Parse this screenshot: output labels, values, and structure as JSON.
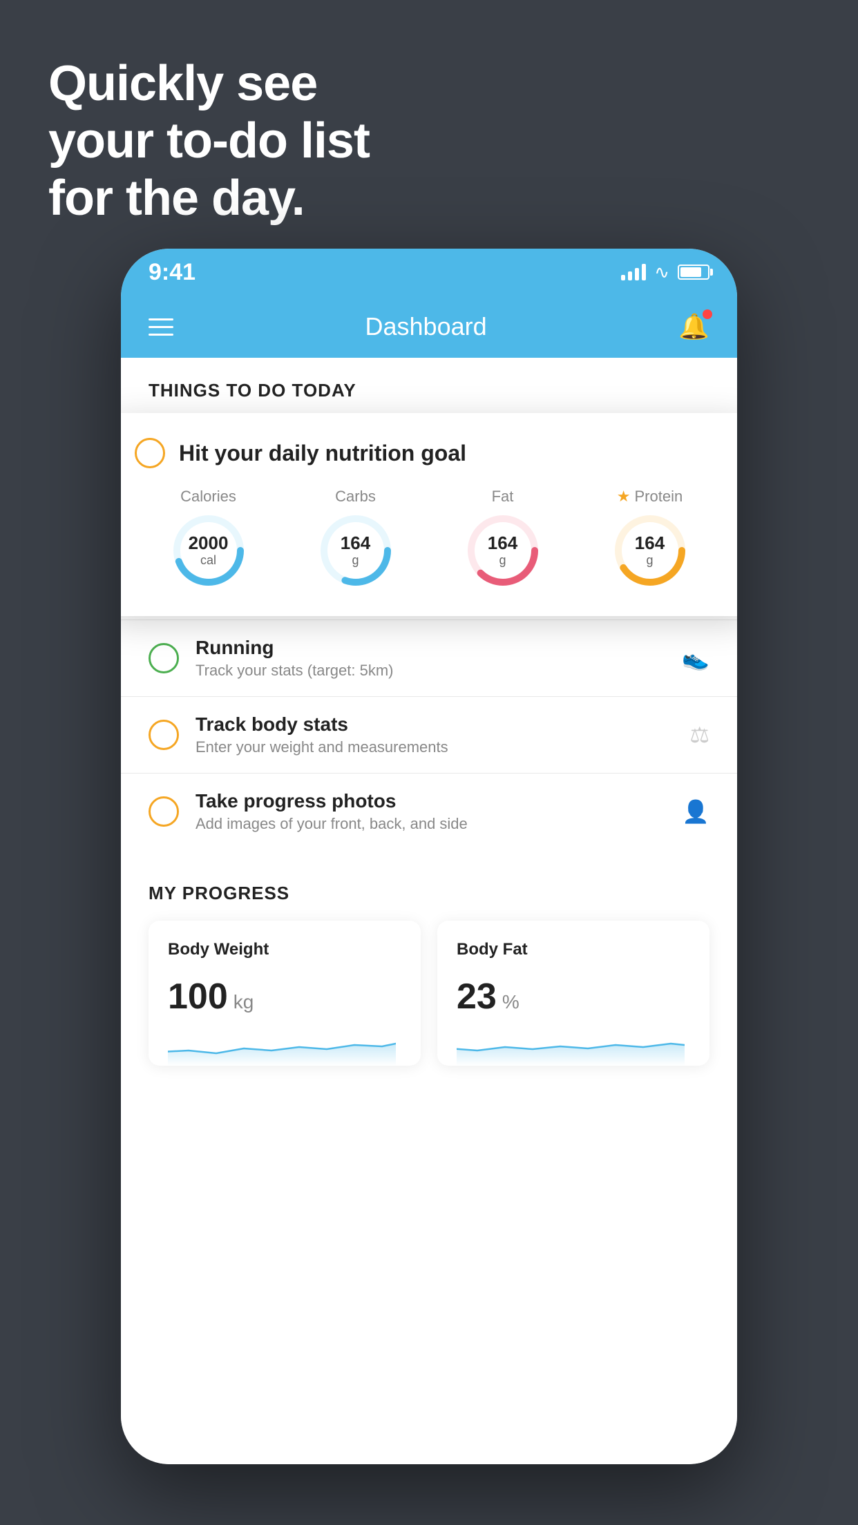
{
  "headline": {
    "line1": "Quickly see",
    "line2": "your to-do list",
    "line3": "for the day."
  },
  "statusBar": {
    "time": "9:41"
  },
  "header": {
    "title": "Dashboard"
  },
  "thingsToDo": {
    "sectionTitle": "THINGS TO DO TODAY"
  },
  "nutritionCard": {
    "title": "Hit your daily nutrition goal",
    "macros": [
      {
        "label": "Calories",
        "value": "2000",
        "unit": "cal",
        "color": "#4db8e8",
        "starred": false
      },
      {
        "label": "Carbs",
        "value": "164",
        "unit": "g",
        "color": "#4db8e8",
        "starred": false
      },
      {
        "label": "Fat",
        "value": "164",
        "unit": "g",
        "color": "#e85c78",
        "starred": false
      },
      {
        "label": "Protein",
        "value": "164",
        "unit": "g",
        "color": "#f5a623",
        "starred": true
      }
    ]
  },
  "todoItems": [
    {
      "title": "Running",
      "subtitle": "Track your stats (target: 5km)",
      "circleColor": "green",
      "iconType": "shoe"
    },
    {
      "title": "Track body stats",
      "subtitle": "Enter your weight and measurements",
      "circleColor": "yellow",
      "iconType": "scale"
    },
    {
      "title": "Take progress photos",
      "subtitle": "Add images of your front, back, and side",
      "circleColor": "yellow",
      "iconType": "person"
    }
  ],
  "progress": {
    "sectionTitle": "MY PROGRESS",
    "cards": [
      {
        "title": "Body Weight",
        "value": "100",
        "unit": "kg"
      },
      {
        "title": "Body Fat",
        "value": "23",
        "unit": "%"
      }
    ]
  }
}
